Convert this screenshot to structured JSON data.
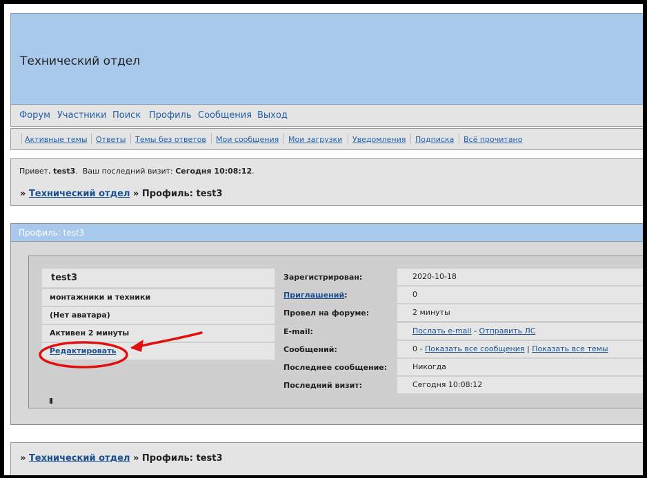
{
  "header": {
    "title": "Технический отдел"
  },
  "nav": [
    "Форум",
    "Участники",
    "Поиск",
    "Профиль",
    "Сообщения",
    "Выход"
  ],
  "subnav": [
    "Активные темы",
    "Ответы",
    "Темы без ответов",
    "Мои сообщения",
    "Мои загрузки",
    "Уведомления",
    "Подписка",
    "Всё прочитано"
  ],
  "greeting": {
    "prefix": "Привет,",
    "user": "test3",
    "last_visit_label": "Ваш последний визит:",
    "last_visit_value": "Сегодня 10:08:12"
  },
  "breadcrumb": {
    "sep": "»",
    "link": "Технический отдел",
    "current": "Профиль: test3"
  },
  "profile": {
    "heading": "Профиль: test3",
    "username": "test3",
    "group": "монтажники и техники",
    "avatar": "(Нет аватара)",
    "activity": "Активен 2 минуты",
    "edit": "Редактировать",
    "fields": {
      "registered": {
        "label": "Зарегистрирован:",
        "value": "2020-10-18"
      },
      "invites": {
        "label": "Приглашений",
        "colon": ":",
        "value": "0"
      },
      "online": {
        "label": "Провел на форуме:",
        "value": "2 минуты"
      },
      "email": {
        "label": "E-mail:",
        "send_email": "Послать e-mail",
        "dash": "-",
        "send_pm": "Отправить ЛС"
      },
      "posts": {
        "label": "Сообщений:",
        "value": "0 -",
        "show_posts": "Показать все сообщения",
        "pipe": "|",
        "show_topics": "Показать все темы"
      },
      "last_post": {
        "label": "Последнее сообщение:",
        "value": "Никогда"
      },
      "last_visit": {
        "label": "Последний визит:",
        "value": "Сегодня 10:08:12"
      }
    }
  },
  "annotation_color": "#e01010"
}
